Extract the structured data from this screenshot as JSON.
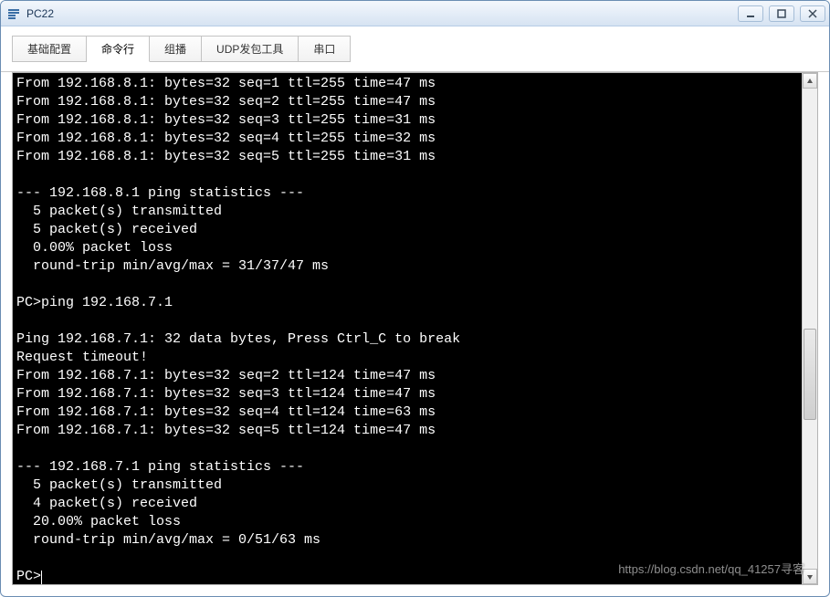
{
  "window": {
    "title": "PC22"
  },
  "tabs": [
    {
      "id": "basic",
      "label": "基础配置"
    },
    {
      "id": "cli",
      "label": "命令行"
    },
    {
      "id": "mcast",
      "label": "组播"
    },
    {
      "id": "udp",
      "label": "UDP发包工具"
    },
    {
      "id": "serial",
      "label": "串口"
    }
  ],
  "active_tab": "cli",
  "terminal": {
    "lines": [
      "From 192.168.8.1: bytes=32 seq=1 ttl=255 time=47 ms",
      "From 192.168.8.1: bytes=32 seq=2 ttl=255 time=47 ms",
      "From 192.168.8.1: bytes=32 seq=3 ttl=255 time=31 ms",
      "From 192.168.8.1: bytes=32 seq=4 ttl=255 time=32 ms",
      "From 192.168.8.1: bytes=32 seq=5 ttl=255 time=31 ms",
      "",
      "--- 192.168.8.1 ping statistics ---",
      "  5 packet(s) transmitted",
      "  5 packet(s) received",
      "  0.00% packet loss",
      "  round-trip min/avg/max = 31/37/47 ms",
      "",
      "PC>ping 192.168.7.1",
      "",
      "Ping 192.168.7.1: 32 data bytes, Press Ctrl_C to break",
      "Request timeout!",
      "From 192.168.7.1: bytes=32 seq=2 ttl=124 time=47 ms",
      "From 192.168.7.1: bytes=32 seq=3 ttl=124 time=47 ms",
      "From 192.168.7.1: bytes=32 seq=4 ttl=124 time=63 ms",
      "From 192.168.7.1: bytes=32 seq=5 ttl=124 time=47 ms",
      "",
      "--- 192.168.7.1 ping statistics ---",
      "  5 packet(s) transmitted",
      "  4 packet(s) received",
      "  20.00% packet loss",
      "  round-trip min/avg/max = 0/51/63 ms",
      ""
    ],
    "prompt": "PC>"
  },
  "watermark": "https://blog.csdn.net/qq_41257寻客"
}
